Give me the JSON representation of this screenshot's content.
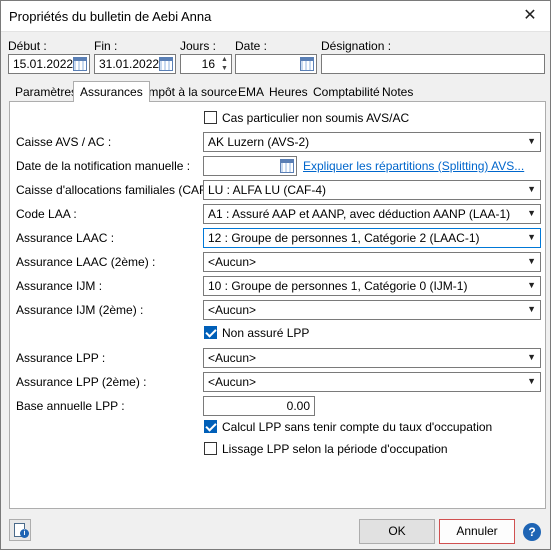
{
  "window": {
    "title": "Propriétés du bulletin de Aebi Anna",
    "close_icon": "close-icon"
  },
  "header": {
    "debut_label": "Début :",
    "debut_value": "15.01.2022",
    "fin_label": "Fin :",
    "fin_value": "31.01.2022",
    "jours_label": "Jours :",
    "jours_value": "16",
    "date_label": "Date :",
    "date_value": "",
    "designation_label": "Désignation :",
    "designation_value": ""
  },
  "tabs": [
    {
      "label": "Paramètres"
    },
    {
      "label": "Assurances"
    },
    {
      "label": "Impôt à la source"
    },
    {
      "label": "EMA"
    },
    {
      "label": "Heures"
    },
    {
      "label": "Comptabilité"
    },
    {
      "label": "Notes"
    }
  ],
  "assurances": {
    "cas_particulier_label": "Cas particulier non soumis AVS/AC",
    "cas_particulier_checked": false,
    "caisse_avs_label": "Caisse AVS / AC :",
    "caisse_avs_value": "AK Luzern (AVS-2)",
    "date_notification_label": "Date de la notification manuelle :",
    "date_notification_value": "",
    "splitting_link": "Expliquer les répartitions (Splitting) AVS...",
    "caf_label": "Caisse d'allocations familiales (CAF) :",
    "caf_value": "LU : ALFA LU (CAF-4)",
    "code_laa_label": "Code LAA :",
    "code_laa_value": "A1 : Assuré AAP et AANP, avec déduction AANP (LAA-1)",
    "laac_label": "Assurance LAAC :",
    "laac_value": "12 : Groupe de personnes 1, Catégorie 2 (LAAC-1)",
    "laac2_label": "Assurance LAAC (2ème) :",
    "laac2_value": "<Aucun>",
    "ijm_label": "Assurance IJM :",
    "ijm_value": "10 : Groupe de personnes 1, Catégorie 0 (IJM-1)",
    "ijm2_label": "Assurance IJM (2ème) :",
    "ijm2_value": "<Aucun>",
    "non_assure_lpp_label": "Non assuré LPP",
    "non_assure_lpp_checked": true,
    "lpp_label": "Assurance LPP :",
    "lpp_value": "<Aucun>",
    "lpp2_label": "Assurance LPP (2ème) :",
    "lpp2_value": "<Aucun>",
    "base_lpp_label": "Base annuelle LPP :",
    "base_lpp_value": "0.00",
    "calcul_lpp_label": "Calcul LPP sans tenir compte du taux d'occupation",
    "calcul_lpp_checked": true,
    "lissage_lpp_label": "Lissage LPP selon la période d'occupation",
    "lissage_lpp_checked": false
  },
  "footer": {
    "ok_label": "OK",
    "annuler_label": "Annuler",
    "help_glyph": "?",
    "info_icon": "employee-info-icon"
  },
  "colors": {
    "accent": "#0078d7",
    "link": "#0066cc",
    "checkbox_on": "#005fb8",
    "cancel_border": "#d05050"
  }
}
